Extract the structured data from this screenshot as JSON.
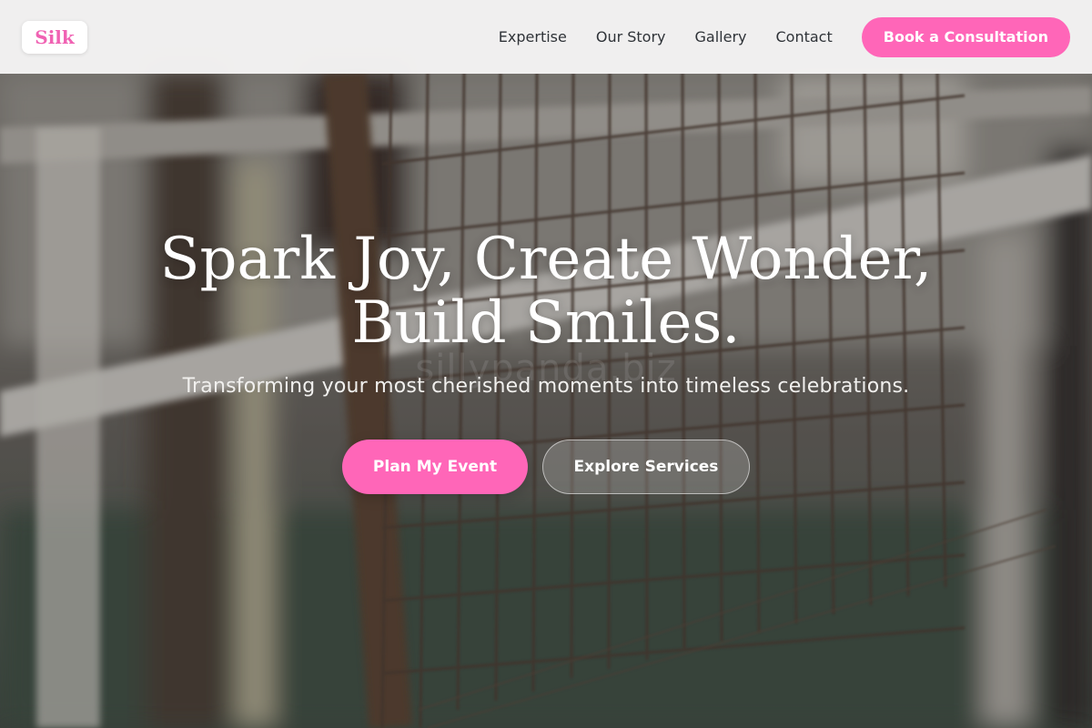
{
  "brand": {
    "logo_text": "Silk",
    "accent_color": "#ff66b8"
  },
  "nav": {
    "items": [
      {
        "label": "Expertise"
      },
      {
        "label": "Our Story"
      },
      {
        "label": "Gallery"
      },
      {
        "label": "Contact"
      }
    ],
    "cta_label": "Book a Consultation"
  },
  "hero": {
    "headline_line1": "Spark Joy, Create Wonder,",
    "headline_line2": "Build Smiles.",
    "subheadline": "Transforming your most cherished moments into timeless celebrations.",
    "watermark": "sillypanda.biz",
    "primary_button": "Plan My Event",
    "secondary_button": "Explore Services",
    "background_image": "blurred-metal-fence-photo"
  }
}
